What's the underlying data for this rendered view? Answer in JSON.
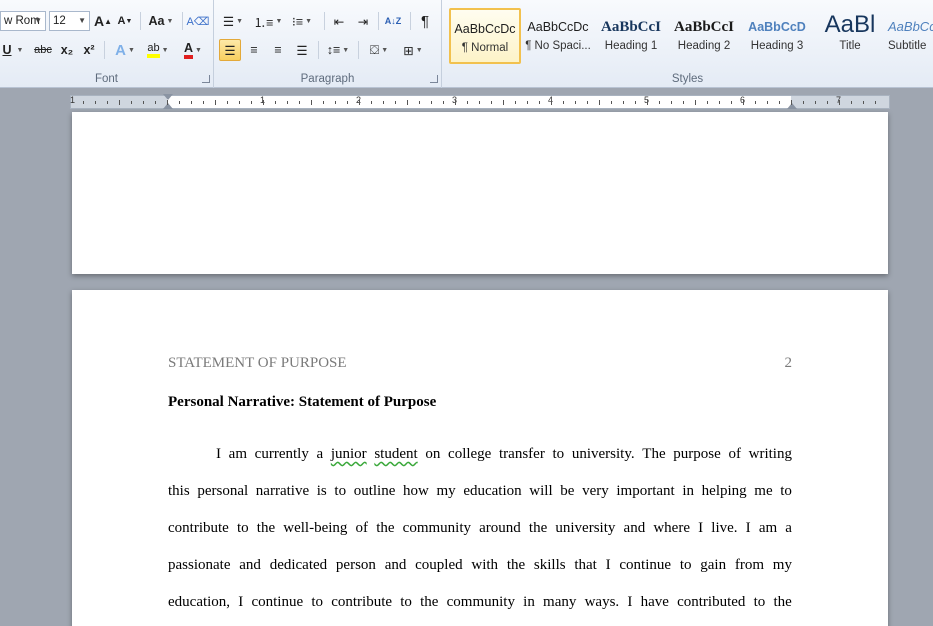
{
  "ribbon": {
    "font": {
      "font_name": "w Rom",
      "font_size": "12",
      "grow_label": "A",
      "shrink_label": "A",
      "case_label": "Aa",
      "underline_label": "U",
      "strike_label": "abc",
      "subscript_label": "x₂",
      "superscript_label": "x²",
      "effects_label": "A",
      "highlight_label": "ab",
      "color_label": "A",
      "group_label": "Font"
    },
    "paragraph": {
      "group_label": "Paragraph",
      "sort_label": "A↓Z",
      "show_marks_label": "¶"
    },
    "styles": {
      "group_label": "Styles",
      "items": [
        {
          "preview": "AaBbCcDc",
          "name": "¶ Normal"
        },
        {
          "preview": "AaBbCcDc",
          "name": "¶ No Spaci..."
        },
        {
          "preview": "AaBbCcI",
          "name": "Heading 1"
        },
        {
          "preview": "AaBbCcI",
          "name": "Heading 2"
        },
        {
          "preview": "AaBbCcD",
          "name": "Heading 3"
        },
        {
          "preview": "AaBl",
          "name": "Title"
        },
        {
          "preview": "AaBbCc",
          "name": "Subtitle"
        }
      ]
    }
  },
  "ruler": {
    "numbers": [
      "1",
      "1",
      "2",
      "3",
      "4",
      "5",
      "6",
      "7"
    ]
  },
  "document": {
    "running_head": "STATEMENT OF PURPOSE",
    "page_number": "2",
    "title": "Personal Narrative: Statement of Purpose",
    "lines": [
      "I am currently a junior  student on college transfer to university. The purpose of writing",
      "this personal narrative is to outline how my education will be very important in helping me to",
      "contribute to the well-being of the community around the university and where I live. I am a",
      "passionate and dedicated person and coupled with the skills that I continue to gain from my",
      "education, I continue to contribute to the community in many ways. I have contributed to the"
    ]
  }
}
